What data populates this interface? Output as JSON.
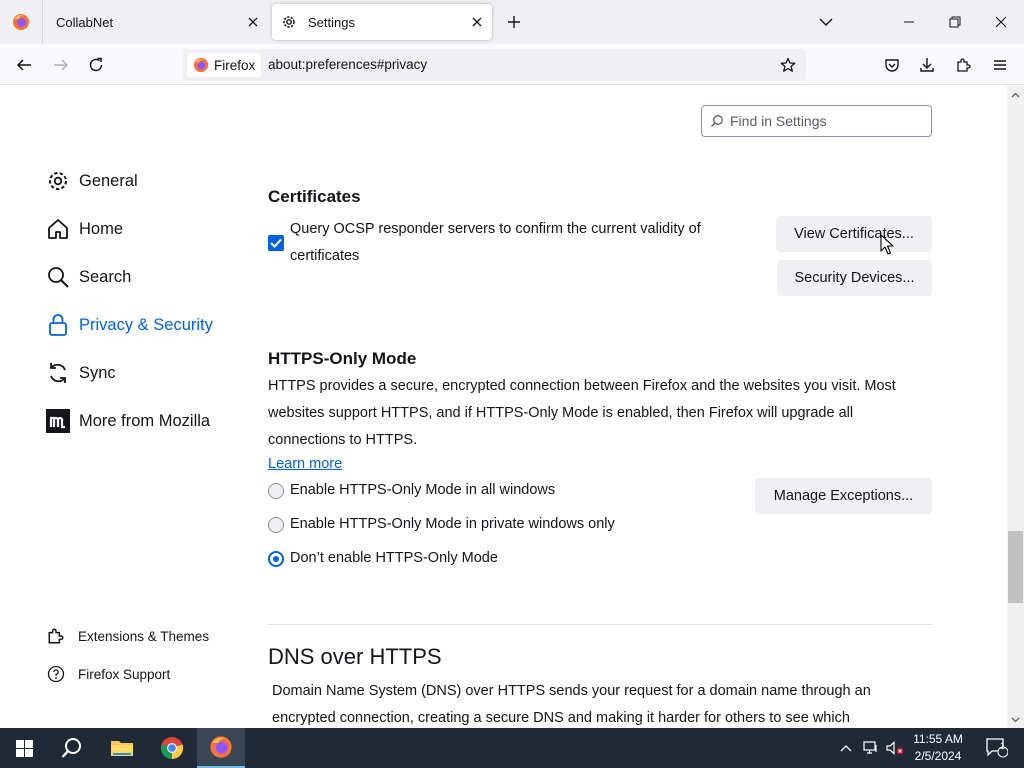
{
  "tabs": {
    "inactive_label": "CollabNet",
    "active_label": "Settings"
  },
  "navbar": {
    "identity_label": "Firefox",
    "url": "about:preferences#privacy"
  },
  "search": {
    "placeholder": "Find in Settings"
  },
  "sidebar": {
    "items": [
      {
        "label": "General",
        "icon": "gear-icon"
      },
      {
        "label": "Home",
        "icon": "home-icon"
      },
      {
        "label": "Search",
        "icon": "search-icon"
      },
      {
        "label": "Privacy & Security",
        "icon": "lock-icon"
      },
      {
        "label": "Sync",
        "icon": "sync-icon"
      },
      {
        "label": "More from Mozilla",
        "icon": "mozilla-icon"
      }
    ],
    "footer": [
      {
        "label": "Extensions & Themes",
        "icon": "puzzle-icon"
      },
      {
        "label": "Firefox Support",
        "icon": "help-icon"
      }
    ]
  },
  "certificates": {
    "heading": "Certificates",
    "ocsp_label_line1": "Query OCSP responder servers to confirm the current validity of",
    "ocsp_label_line2": "certificates",
    "ocsp_checked": true,
    "view_button": "View Certificates...",
    "devices_button": "Security Devices..."
  },
  "https_only": {
    "heading": "HTTPS-Only Mode",
    "desc_line1": "HTTPS provides a secure, encrypted connection between Firefox and the websites you visit. Most",
    "desc_line2": "websites support HTTPS, and if HTTPS-Only Mode is enabled, then Firefox will upgrade all",
    "desc_line3": "connections to HTTPS.",
    "learn_more": "Learn more",
    "options": [
      {
        "label": "Enable HTTPS-Only Mode in all windows",
        "selected": false
      },
      {
        "label": "Enable HTTPS-Only Mode in private windows only",
        "selected": false
      },
      {
        "label": "Don’t enable HTTPS-Only Mode",
        "selected": true
      }
    ],
    "exceptions_button": "Manage Exceptions..."
  },
  "dns": {
    "heading": "DNS over HTTPS",
    "desc_line1": "Domain Name System (DNS) over HTTPS sends your request for a domain name through an",
    "desc_line2": "encrypted connection, creating a secure DNS and making it harder for others to see which"
  },
  "taskbar": {
    "time": "11:55 AM",
    "date": "2/5/2024",
    "notification_count": "1"
  },
  "colors": {
    "accent": "#0061e0",
    "taskbar": "#1f2a36"
  }
}
